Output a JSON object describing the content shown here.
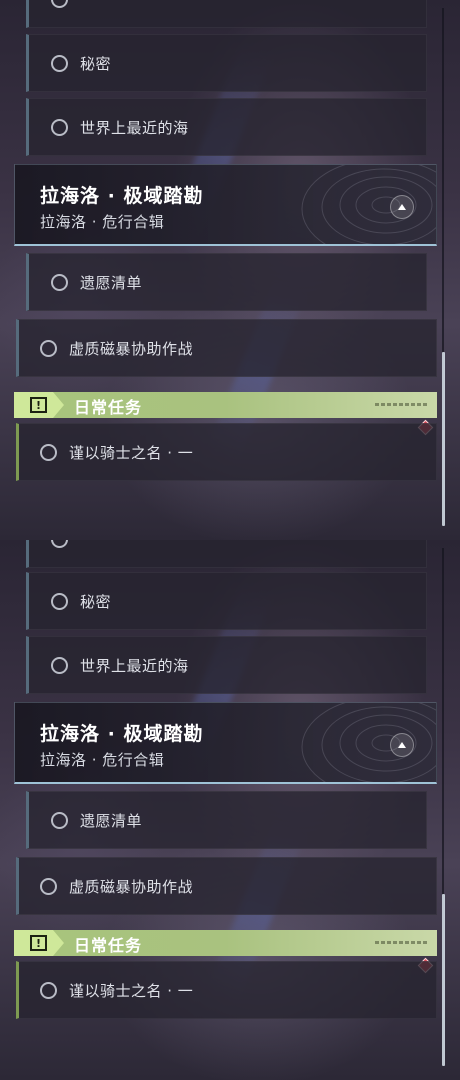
{
  "panels": [
    {
      "sub_items": [
        "秘密",
        "世界上最近的海"
      ],
      "group": {
        "title": "拉海洛 · 极域踏勘",
        "subtitle": "拉海洛 · 危行合辑"
      },
      "group_sub_item": "遗愿清单",
      "main_item": "虚质磁暴协助作战",
      "daily": {
        "header": "日常任务",
        "icon_text": "!",
        "item": "谨以骑士之名 · 一"
      }
    },
    {
      "sub_items": [
        "秘密",
        "世界上最近的海"
      ],
      "group": {
        "title": "拉海洛 · 极域踏勘",
        "subtitle": "拉海洛 · 危行合辑"
      },
      "group_sub_item": "遗愿清单",
      "main_item": "虚质磁暴协助作战",
      "daily": {
        "header": "日常任务",
        "icon_text": "!",
        "item": "谨以骑士之名 · 一"
      }
    }
  ],
  "colors": {
    "daily_accent": "#a8c47c",
    "alert": "#d84452",
    "group_border": "#9fc3d7"
  },
  "icons": {
    "quest_status": "circle-outline-icon",
    "collapse": "triangle-up-icon",
    "daily": "exclamation-box-icon",
    "alert": "red-diamond-icon"
  }
}
